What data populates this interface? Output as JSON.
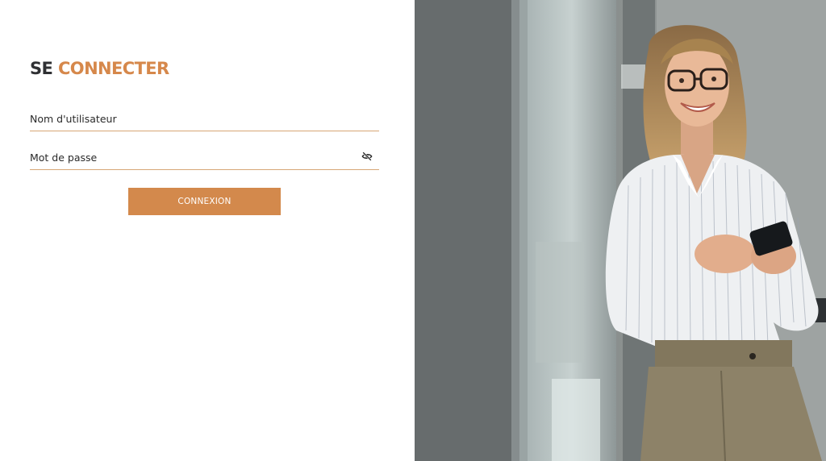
{
  "login": {
    "title_part1": "SE",
    "title_part2": "CONNECTER",
    "username": {
      "placeholder": "Nom d'utilisateur",
      "value": ""
    },
    "password": {
      "placeholder": "Mot de passe",
      "value": ""
    },
    "toggle_visibility_icon": "eye-slash-icon",
    "submit_label": "CONNEXION"
  },
  "colors": {
    "accent": "#d3894c",
    "title_dark": "#2f3033",
    "field_underline": "#d7a676"
  },
  "hero_image": {
    "subject": "smiling-woman-with-phone-photo"
  }
}
